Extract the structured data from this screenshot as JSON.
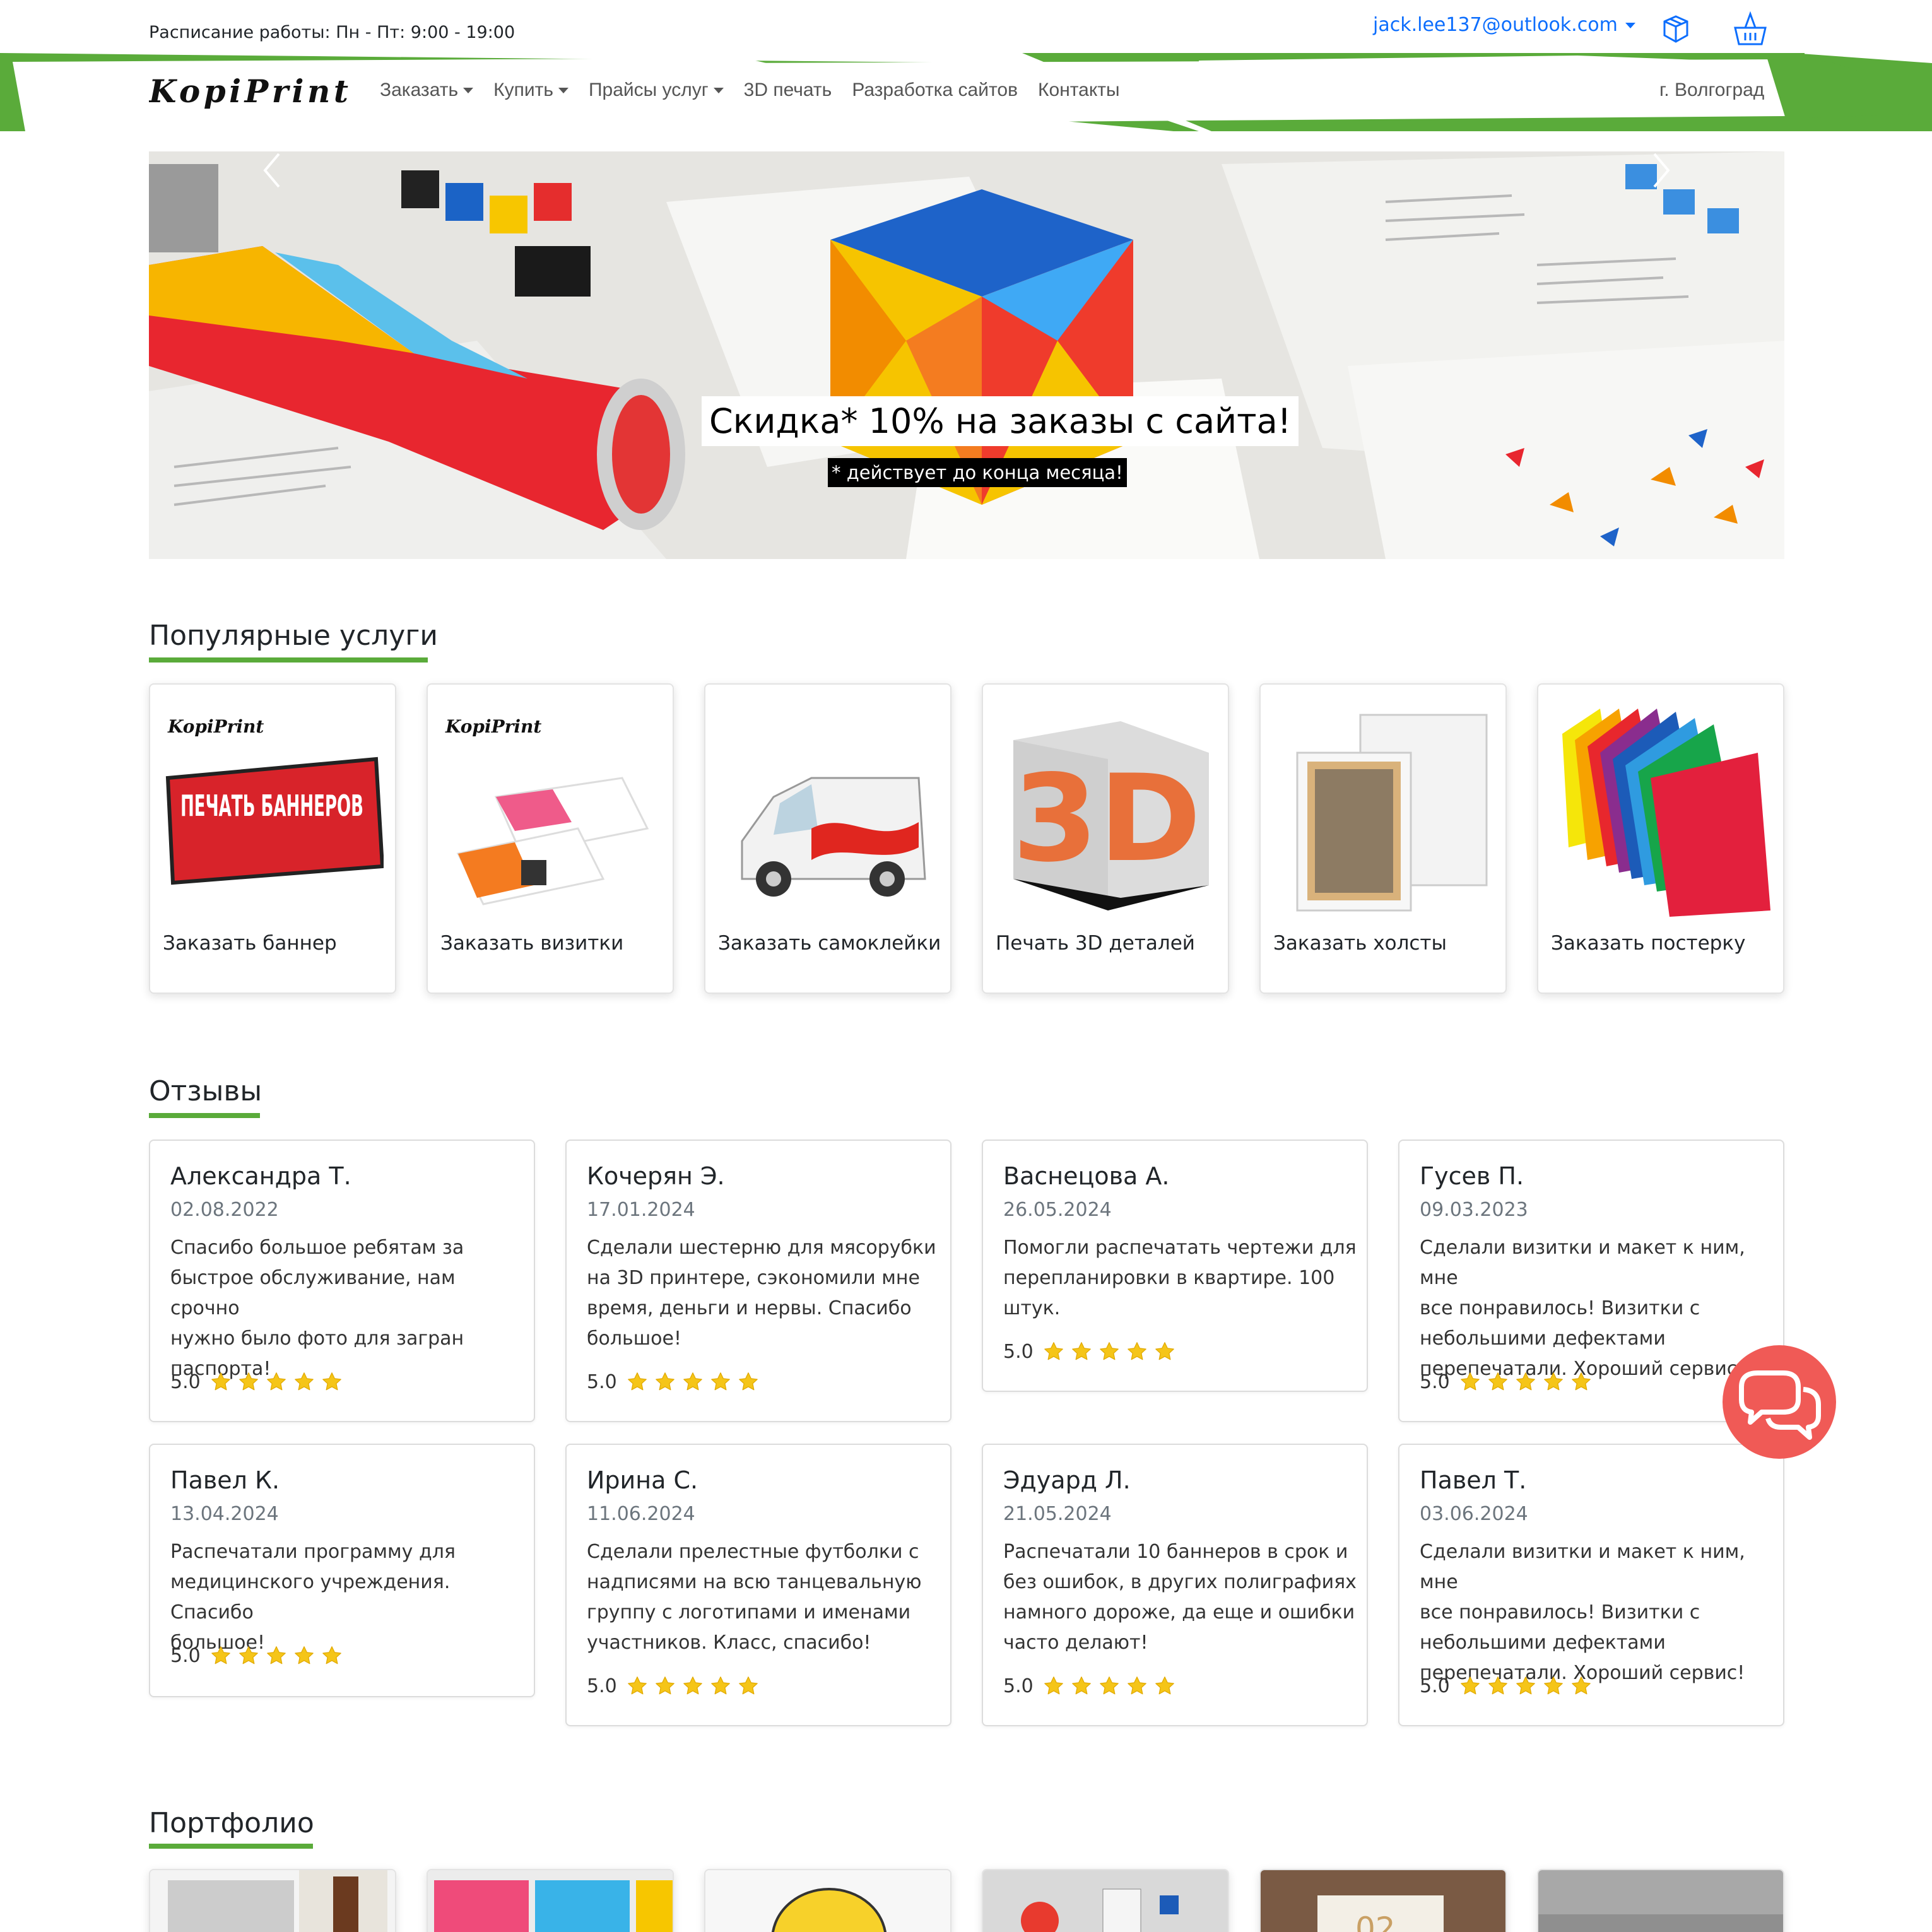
{
  "topbar": {
    "schedule": "Расписание работы: Пн - Пт: 9:00 - 19:00",
    "user_email": "jack.lee137@outlook.com"
  },
  "brand": {
    "logo_text": "KopiPrint",
    "accent": "#5aab3a"
  },
  "nav": {
    "items": [
      {
        "label": "Заказать",
        "dropdown": true
      },
      {
        "label": "Купить",
        "dropdown": true
      },
      {
        "label": "Прайсы услуг",
        "dropdown": true
      },
      {
        "label": "3D печать",
        "dropdown": false
      },
      {
        "label": "Разработка сайтов",
        "dropdown": false
      },
      {
        "label": "Контакты",
        "dropdown": false
      }
    ],
    "city": "г. Волгоград"
  },
  "hero": {
    "caption": "Скидка* 10% на заказы с сайта!",
    "subcaption": "* действует до конца месяца!"
  },
  "services": {
    "title": "Популярные услуги",
    "items": [
      {
        "label": "Заказать баннер",
        "image_text": "ПЕЧАТЬ БАННЕРОВ"
      },
      {
        "label": "Заказать визитки"
      },
      {
        "label": "Заказать самоклейки"
      },
      {
        "label": "Печать 3D деталей",
        "image_text": "3D"
      },
      {
        "label": "Заказать холсты"
      },
      {
        "label": "Заказать постерку"
      }
    ]
  },
  "reviews": {
    "title": "Отзывы",
    "items": [
      {
        "name": "Александра Т.",
        "date": "02.08.2022",
        "lines": [
          "Спасибо большое ребятам за",
          "быстрое обслуживание, нам срочно",
          "нужно было фото для загран",
          "паспорта!"
        ],
        "rating": "5.0"
      },
      {
        "name": "Кочерян Э.",
        "date": "17.01.2024",
        "lines": [
          "Сделали шестерню для мясорубки",
          "на 3D принтере, сэкономили мне",
          "время, деньги и нервы. Спасибо",
          "большое!"
        ],
        "rating": "5.0"
      },
      {
        "name": "Васнецова А.",
        "date": "26.05.2024",
        "lines": [
          "Помогли распечатать чертежи для",
          "перепланировки в квартире. 100",
          "штук."
        ],
        "rating": "5.0"
      },
      {
        "name": "Гусев П.",
        "date": "09.03.2023",
        "lines": [
          "Сделали визитки и макет к ним, мне",
          "все понравилось! Визитки с",
          "небольшими дефектами",
          "перепечатали. Хороший сервис!"
        ],
        "rating": "5.0"
      },
      {
        "name": "Павел К.",
        "date": "13.04.2024",
        "lines": [
          "Распечатали программу для",
          "медицинского учреждения. Спасибо",
          "большое!"
        ],
        "rating": "5.0"
      },
      {
        "name": "Ирина С.",
        "date": "11.06.2024",
        "lines": [
          "Сделали прелестные футболки с",
          "надписями на всю танцевальную",
          "группу с логотипами и именами",
          "участников. Класс, спасибо!"
        ],
        "rating": "5.0"
      },
      {
        "name": "Эдуард Л.",
        "date": "21.05.2024",
        "lines": [
          "Распечатали 10 баннеров в срок и",
          "без ошибок, в других полиграфиях",
          "намного дороже, да еще и ошибки",
          "часто делают!"
        ],
        "rating": "5.0"
      },
      {
        "name": "Павел Т.",
        "date": "03.06.2024",
        "lines": [
          "Сделали визитки и макет к ним, мне",
          "все понравилось! Визитки с",
          "небольшими дефектами",
          "перепечатали. Хороший сервис!"
        ],
        "rating": "5.0"
      }
    ]
  },
  "portfolio": {
    "title": "Портфолио",
    "image_text": "02"
  },
  "colors": {
    "accent_green": "#5aab3a",
    "link_blue": "#0d6efd",
    "chat_red": "#f05a56",
    "star_yellow": "#f5c518"
  }
}
